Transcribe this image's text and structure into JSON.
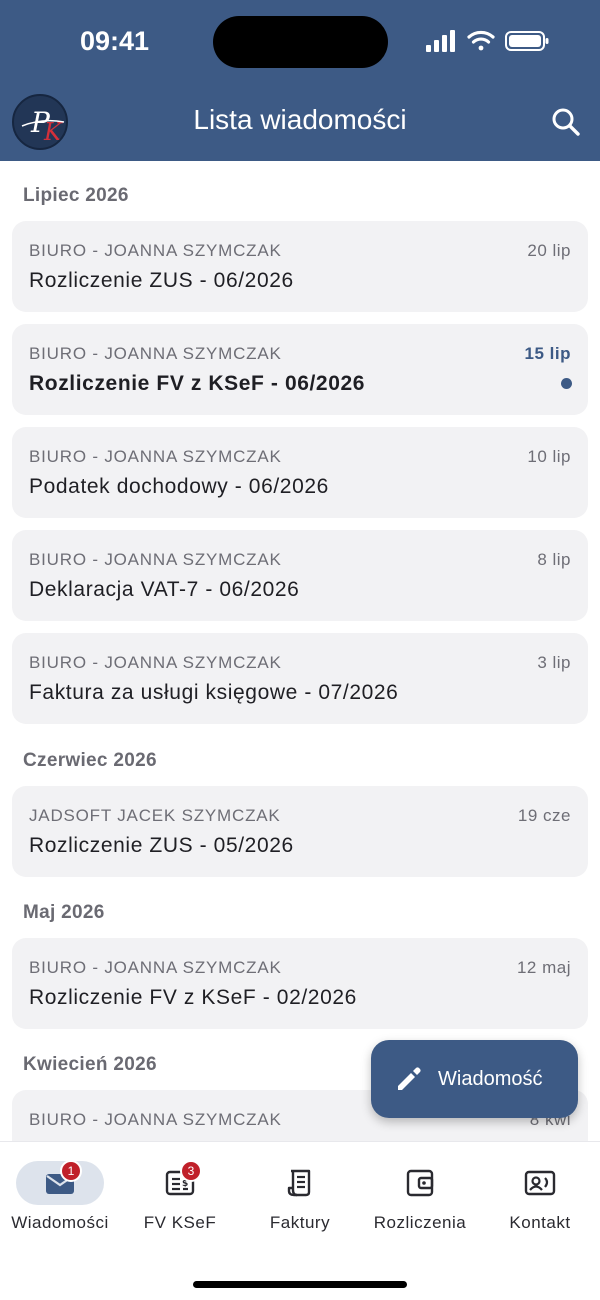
{
  "status_bar": {
    "time": "09:41"
  },
  "header": {
    "title": "Lista wiadomości",
    "logo_letters": "PK"
  },
  "sections": [
    {
      "label": "Lipiec 2026"
    },
    {
      "label": "Czerwiec 2026"
    },
    {
      "label": "Maj 2026"
    },
    {
      "label": "Kwiecień 2026"
    }
  ],
  "messages": [
    {
      "sender": "BIURO - JOANNA SZYMCZAK",
      "date": "20 lip",
      "subject": "Rozliczenie ZUS - 06/2026",
      "unread": false
    },
    {
      "sender": "BIURO - JOANNA SZYMCZAK",
      "date": "15 lip",
      "subject": "Rozliczenie FV z KSeF - 06/2026",
      "unread": true
    },
    {
      "sender": "BIURO - JOANNA SZYMCZAK",
      "date": "10 lip",
      "subject": "Podatek dochodowy - 06/2026",
      "unread": false
    },
    {
      "sender": "BIURO - JOANNA SZYMCZAK",
      "date": "8 lip",
      "subject": "Deklaracja VAT-7 - 06/2026",
      "unread": false
    },
    {
      "sender": "BIURO - JOANNA SZYMCZAK",
      "date": "3 lip",
      "subject": "Faktura za usługi księgowe - 07/2026",
      "unread": false
    },
    {
      "sender": "JADSOFT JACEK SZYMCZAK",
      "date": "19 cze",
      "subject": "Rozliczenie ZUS - 05/2026",
      "unread": false
    },
    {
      "sender": "BIURO - JOANNA SZYMCZAK",
      "date": "12 maj",
      "subject": "Rozliczenie FV z KSeF - 02/2026",
      "unread": false
    },
    {
      "sender": "BIURO - JOANNA SZYMCZAK",
      "date": "8 kwi",
      "subject": "",
      "unread": false
    }
  ],
  "fab": {
    "label": "Wiadomość",
    "icon": "pencil-icon"
  },
  "bottom_nav": [
    {
      "label": "Wiadomości",
      "icon": "mail-icon",
      "badge": "1",
      "active": true
    },
    {
      "label": "FV KSeF",
      "icon": "invoice-icon",
      "badge": "3",
      "active": false
    },
    {
      "label": "Faktury",
      "icon": "receipt-icon",
      "badge": "",
      "active": false
    },
    {
      "label": "Rozliczenia",
      "icon": "wallet-icon",
      "badge": "",
      "active": false
    },
    {
      "label": "Kontakt",
      "icon": "contact-card-icon",
      "badge": "",
      "active": false
    }
  ],
  "colors": {
    "primary": "#3d5a85",
    "card_bg": "#f2f2f4",
    "badge": "#c0202a",
    "unread_dot": "#3d5a85"
  }
}
